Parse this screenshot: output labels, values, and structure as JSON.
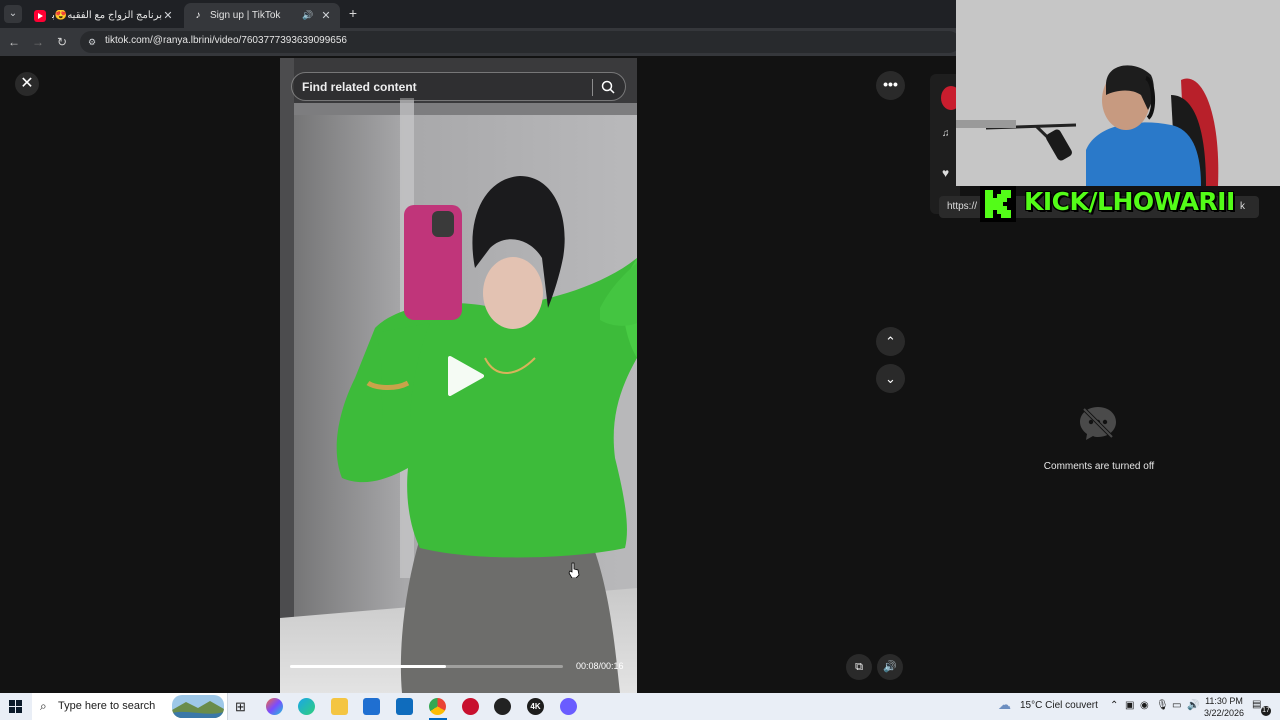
{
  "browser": {
    "tabs": [
      {
        "title": "برنامج الزواج مع الفقيه😍بغات راجل",
        "favicon": "youtube-icon"
      },
      {
        "title": "Sign up | TikTok",
        "favicon": "tiktok-icon"
      }
    ],
    "url": "tiktok.com/@ranya.lbrini/video/7603777393639099656"
  },
  "viewer": {
    "search_placeholder": "Find related content",
    "time": "00:08/00:16",
    "progress": 0.57,
    "comments_off": "Comments are turned off"
  },
  "side": {
    "link_text": "https://",
    "link_tail": "k"
  },
  "overlay": {
    "kick_text": "KICK/LHOWARII"
  },
  "taskbar": {
    "search_placeholder": "Type here to search",
    "weather": "15°C  Ciel couvert",
    "time": "11:30 PM",
    "date": "3/22/2026",
    "notif_count": "17"
  },
  "colors": {
    "kick_green": "#53fc18",
    "sweater_green": "#3dbb3a",
    "page_bg": "#121212"
  }
}
